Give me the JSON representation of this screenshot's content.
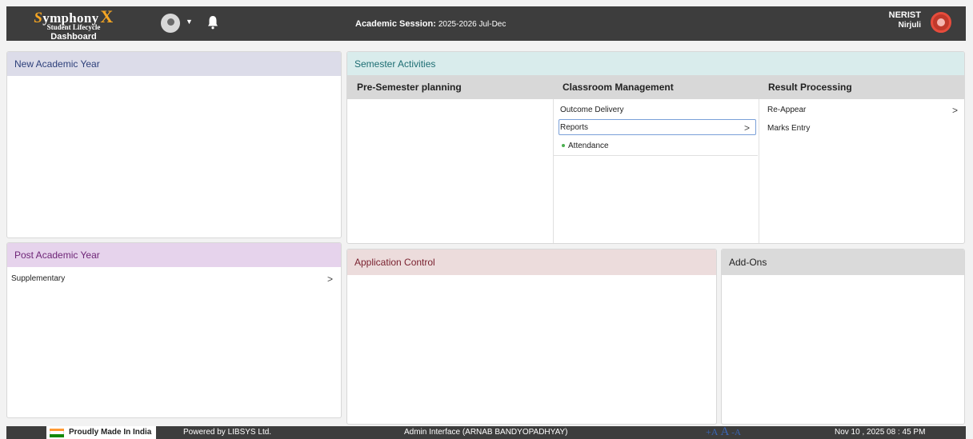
{
  "header": {
    "brand_name": "ymphony",
    "brand_s": "S",
    "brand_x": "X",
    "brand_sub": "Student Lifecycle",
    "brand_page": "Dashboard",
    "session_label": "Academic Session:",
    "session_value": "2025-2026 Jul-Dec",
    "org_name": "NERIST",
    "org_place": "Nirjuli",
    "icons": [
      "user-avatar-icon",
      "caret-down-icon",
      "bell-icon",
      "institution-logo-icon"
    ]
  },
  "new_academic_year": {
    "title": "New Academic Year"
  },
  "post_academic_year": {
    "title": "Post Academic Year",
    "items": [
      {
        "label": "Supplementary"
      }
    ]
  },
  "semester_activities": {
    "title": "Semester Activities",
    "columns": [
      {
        "title": "Pre-Semester planning"
      },
      {
        "title": "Classroom Management",
        "items": [
          {
            "label": "Outcome Delivery"
          },
          {
            "label": "Reports"
          }
        ],
        "submenu": [
          {
            "label": "Attendance"
          }
        ]
      },
      {
        "title": "Result Processing",
        "items": [
          {
            "label": "Re-Appear"
          },
          {
            "label": "Marks Entry"
          }
        ]
      }
    ]
  },
  "application_control": {
    "title": "Application Control"
  },
  "add_ons": {
    "title": "Add-Ons"
  },
  "footer": {
    "made_in": "Proudly Made In India",
    "powered": "Powered by LIBSYS Ltd.",
    "admin": "Admin Interface (ARNAB BANDYOPADHYAY)",
    "font_increase": "+A",
    "font_normal": "A",
    "font_decrease": "-A",
    "datetime": "Nov 10 , 2025 08 : 45 PM"
  },
  "colors": {
    "header_bg": "#3d3d3d",
    "brand_accent": "#f6a623",
    "blue_title_bg": "#dcdce9",
    "purple_title_bg": "#e6d3ec",
    "teal_title_bg": "#d9ecec",
    "rose_title_bg": "#ecdcdc",
    "grey_title_bg": "#dadada",
    "active_border": "#7aa0d8"
  }
}
